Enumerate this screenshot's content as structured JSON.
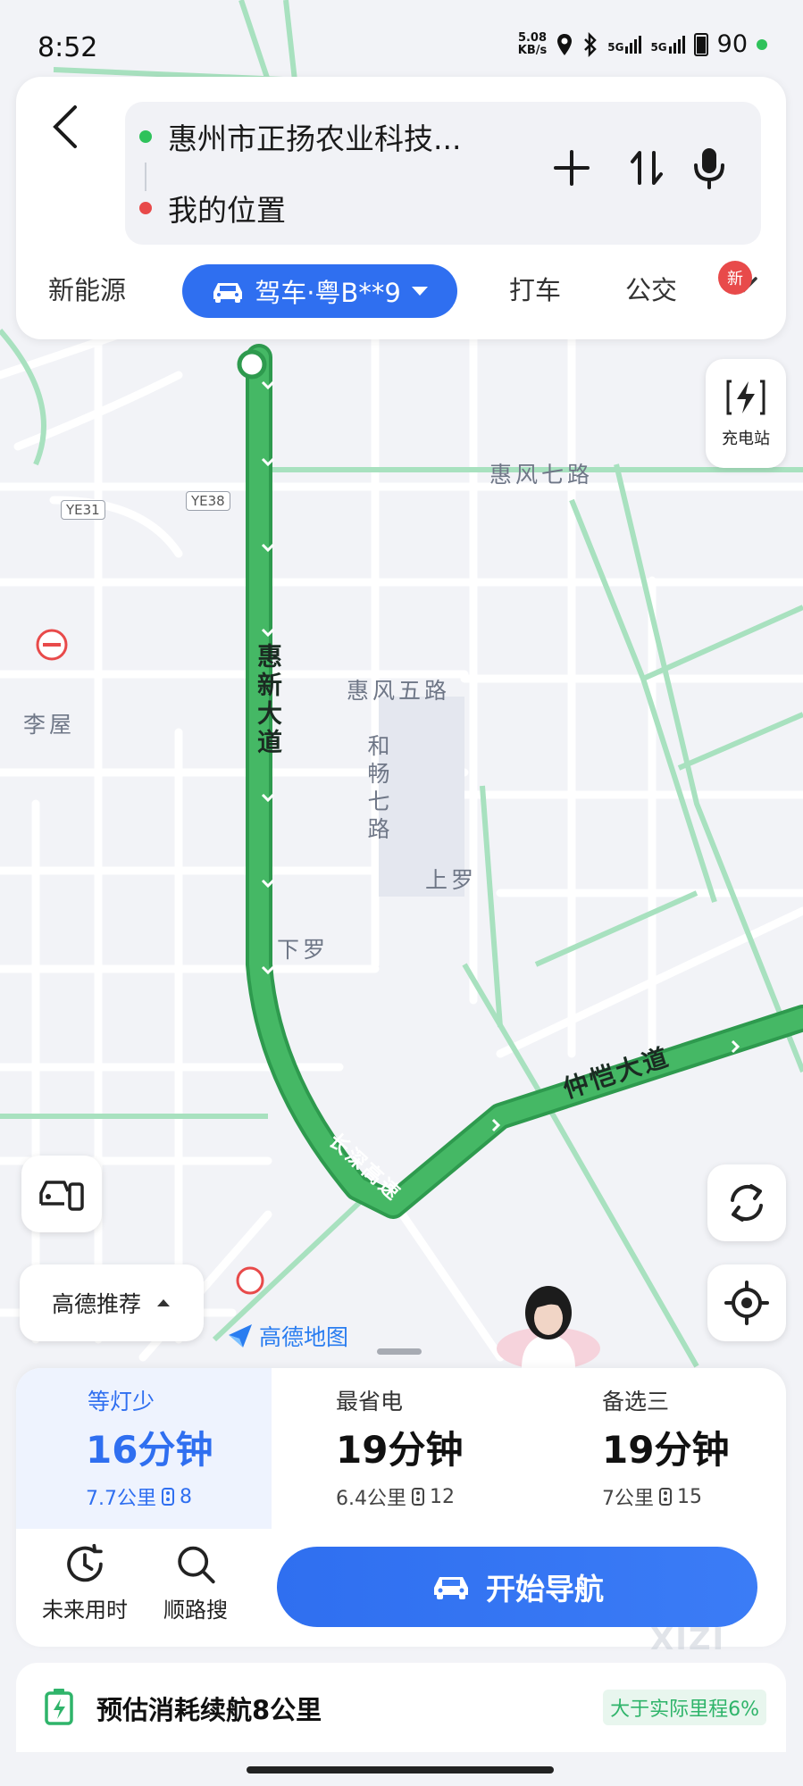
{
  "status_bar": {
    "time": "8:52",
    "net_speed_value": "5.08",
    "net_speed_unit": "KB/s",
    "sim1_label": "5G",
    "sim2_label": "5G",
    "battery_level": "90"
  },
  "route_card": {
    "origin": "惠州市正扬农业科技...",
    "destination": "我的位置",
    "origin_color": "#2fc25b",
    "destination_color": "#e84a4a"
  },
  "mode_tabs": {
    "new_energy": "新能源",
    "drive": "驾车·粤B**9",
    "taxi": "打车",
    "transit": "公交",
    "new_badge": "新"
  },
  "map": {
    "labels": {
      "huifeng7": "惠风七路",
      "huifeng5": "惠风五路",
      "hechang7": "和畅七路",
      "shangluo": "上罗",
      "xialuo": "下罗",
      "liwu": "李屋",
      "huixin": "惠新大道",
      "zhongkai": "仲恺大道",
      "changshen": "长深高速",
      "ye31": "YE31",
      "ye38": "YE38"
    },
    "charging_station": "充电站",
    "recommend": "高德推荐",
    "brand": "高德地图",
    "route_color": "#45b865"
  },
  "routes": [
    {
      "tag": "等灯少",
      "time": "16分钟",
      "distance": "7.7公里",
      "lights": "8"
    },
    {
      "tag": "最省电",
      "time": "19分钟",
      "distance": "6.4公里",
      "lights": "12"
    },
    {
      "tag": "备选三",
      "time": "19分钟",
      "distance": "7公里",
      "lights": "15"
    }
  ],
  "tools": {
    "future_time": "未来用时",
    "along_search": "顺路搜",
    "start_nav": "开始导航"
  },
  "energy": {
    "estimate": "预估消耗续航8公里",
    "badge": "大于实际里程6%"
  },
  "watermark": "XIZI",
  "accent_color": "#2f6ff0"
}
